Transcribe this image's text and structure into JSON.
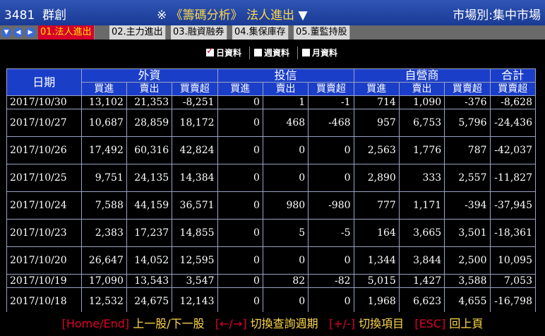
{
  "title_bar": {
    "stock_code": "3481",
    "stock_name": "群創",
    "marker": "※",
    "module": "《籌碼分析》",
    "page": "法人進出",
    "dropdown_glyph": "▼",
    "market": "市場別:集中市場"
  },
  "tabs": [
    {
      "label": "01.法人進出",
      "active": true
    },
    {
      "label": "02.主力進出",
      "active": false
    },
    {
      "label": "03.融資融券",
      "active": false
    },
    {
      "label": "04.集保庫存",
      "active": false
    },
    {
      "label": "05.董監持股",
      "active": false
    }
  ],
  "period_options": [
    {
      "label": "日資料",
      "checked": true
    },
    {
      "label": "週資料",
      "checked": false
    },
    {
      "label": "月資料",
      "checked": false
    }
  ],
  "table": {
    "date_header": "日期",
    "groups": [
      "外資",
      "投信",
      "自營商",
      "合計"
    ],
    "subheaders": [
      "買進",
      "賣出",
      "買賣超",
      "買進",
      "賣出",
      "買賣超",
      "買進",
      "賣出",
      "買賣超",
      "買賣超"
    ],
    "rows": [
      {
        "date": "2017/10/30",
        "values": [
          "13,102",
          "21,353",
          "-8,251",
          "0",
          "1",
          "-1",
          "714",
          "1,090",
          "-376",
          "-8,628"
        ]
      },
      {
        "date": "2017/10/27",
        "values": [
          "10,687",
          "28,859",
          "18,172",
          "0",
          "468",
          "-468",
          "957",
          "6,753",
          "5,796",
          "-24,436"
        ]
      },
      {
        "date": "2017/10/26",
        "values": [
          "17,492",
          "60,316",
          "42,824",
          "0",
          "0",
          "0",
          "2,563",
          "1,776",
          "787",
          "-42,037"
        ]
      },
      {
        "date": "2017/10/25",
        "values": [
          "9,751",
          "24,135",
          "14,384",
          "0",
          "0",
          "0",
          "2,890",
          "333",
          "2,557",
          "-11,827"
        ]
      },
      {
        "date": "2017/10/24",
        "values": [
          "7,588",
          "44,159",
          "36,571",
          "0",
          "980",
          "-980",
          "777",
          "1,171",
          "-394",
          "-37,945"
        ]
      },
      {
        "date": "2017/10/23",
        "values": [
          "2,383",
          "17,237",
          "14,855",
          "0",
          "5",
          "-5",
          "164",
          "3,665",
          "3,501",
          "-18,361"
        ]
      },
      {
        "date": "2017/10/20",
        "values": [
          "26,647",
          "14,052",
          "12,595",
          "0",
          "0",
          "0",
          "1,344",
          "3,844",
          "2,500",
          "10,095"
        ]
      },
      {
        "date": "2017/10/19",
        "values": [
          "17,090",
          "13,543",
          "3,547",
          "0",
          "82",
          "-82",
          "5,015",
          "1,427",
          "3,588",
          "7,053"
        ]
      },
      {
        "date": "2017/10/18",
        "values": [
          "12,532",
          "24,675",
          "12,143",
          "0",
          "0",
          "0",
          "1,968",
          "6,623",
          "4,655",
          "-16,798"
        ]
      }
    ]
  },
  "status_bar": [
    {
      "key": "[Home/End]",
      "desc": "上一股/下一股"
    },
    {
      "key": "[←/→]",
      "desc": "切換查詢週期"
    },
    {
      "key": "[+/-]",
      "desc": "切換項目"
    },
    {
      "key": "[ESC]",
      "desc": "回上頁"
    }
  ],
  "colors": {
    "title_bg": "#1a3a94",
    "active_tab_bg": "#d8002a",
    "active_tab_text": "#ffe600",
    "header_bg": "#1b3ec8",
    "key_text": "#e0002a",
    "desc_text": "#ffd84a"
  }
}
